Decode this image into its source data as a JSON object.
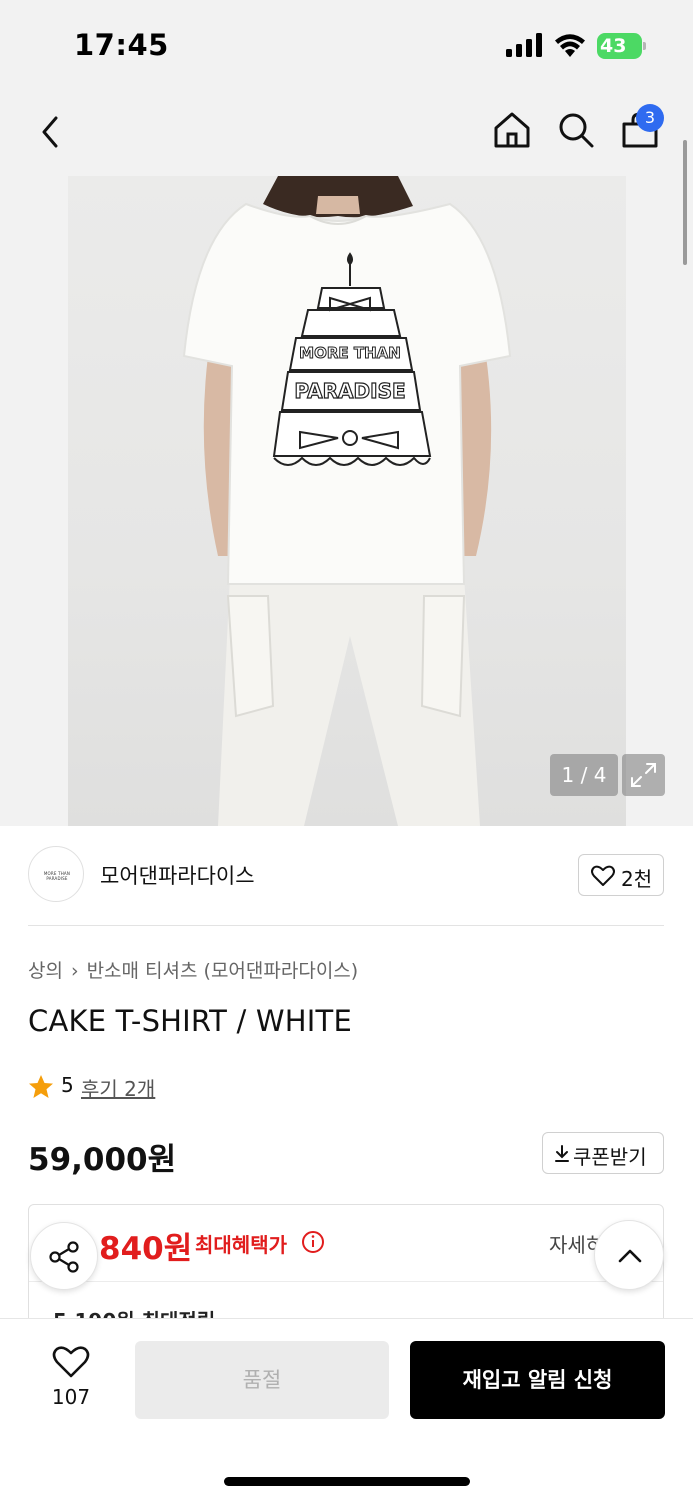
{
  "status_bar": {
    "time": "17:45",
    "battery": "43"
  },
  "nav": {
    "cart_count": "3"
  },
  "gallery": {
    "counter": "1 / 4",
    "print_text_line1": "MORE THAN",
    "print_text_line2": "PARADISE"
  },
  "brand": {
    "logo_text": "MORE THAN PARADISE",
    "name": "모어댄파라다이스",
    "like_count": "2천"
  },
  "breadcrumb": [
    {
      "label": "상의"
    },
    {
      "label": "반소매 티셔츠 (모어댄파라다이스)"
    }
  ],
  "product": {
    "title": "CAKE T-SHIRT / WHITE",
    "rating": "5",
    "review_link": "후기 2개",
    "price": "59,000원",
    "coupon_label": "쿠폰받기"
  },
  "benefit": {
    "price": "840원",
    "label": "최대혜택가",
    "detail": "자세히",
    "points": "5,190원 최대적립"
  },
  "bottom_bar": {
    "wish_count": "107",
    "soldout_label": "품절",
    "restock_label": "재입고 알림 신청"
  },
  "colors": {
    "accent_red": "#e11d1d",
    "badge_blue": "#2f6bf0",
    "star_orange": "#f59e0b",
    "battery_green": "#4cd964"
  },
  "icons": [
    "back-icon",
    "home-icon",
    "search-icon",
    "cart-icon",
    "expand-icon",
    "heart-icon",
    "star-icon",
    "download-icon",
    "info-icon",
    "share-icon",
    "chevron-up-icon"
  ]
}
